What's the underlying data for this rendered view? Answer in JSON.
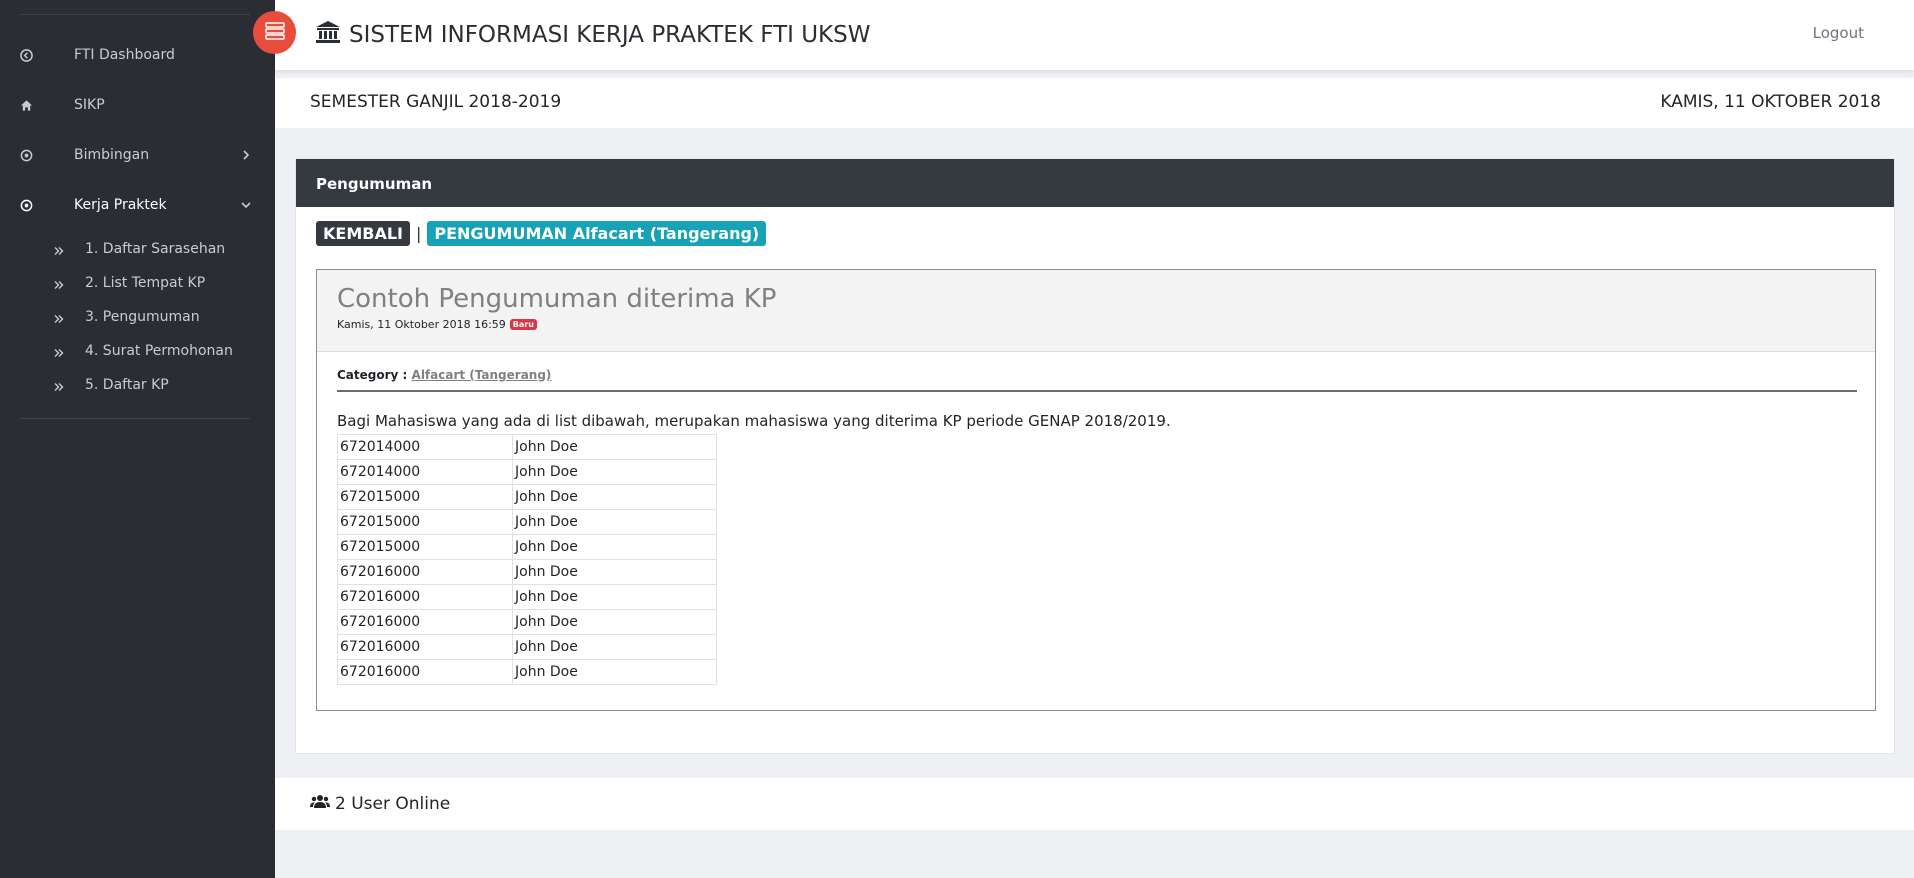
{
  "sidebar": {
    "items": [
      {
        "label": "FTI Dashboard",
        "icon": "arrow-circle-left-icon"
      },
      {
        "label": "SIKP",
        "icon": "home-icon"
      },
      {
        "label": "Bimbingan",
        "icon": "dot-circle-icon"
      },
      {
        "label": "Kerja Praktek",
        "icon": "dot-circle-icon"
      }
    ],
    "subitems": [
      {
        "label": "1. Daftar Sarasehan"
      },
      {
        "label": "2. List Tempat KP"
      },
      {
        "label": "3. Pengumuman"
      },
      {
        "label": "4. Surat Permohonan"
      },
      {
        "label": "5. Daftar KP"
      }
    ]
  },
  "header": {
    "title": "SISTEM INFORMASI KERJA PRAKTEK FTI UKSW",
    "logout": "Logout",
    "semester": "SEMESTER GANJIL 2018-2019",
    "date": "KAMIS, 11 OKTOBER 2018"
  },
  "card": {
    "heading": "Pengumuman",
    "back": "KEMBALI",
    "separator": "|",
    "crumb": "PENGUMUMAN Alfacart (Tangerang)"
  },
  "post": {
    "title": "Contoh Pengumuman diterima KP",
    "meta": "Kamis, 11 Oktober 2018 16:59",
    "badge": "Baru",
    "category_label": "Category :",
    "category_link": "Alfacart (Tangerang)",
    "intro": "Bagi Mahasiswa yang ada di list dibawah, merupakan mahasiswa yang diterima KP periode GENAP 2018/2019.",
    "rows": [
      [
        "672014000",
        "John Doe"
      ],
      [
        "672014000",
        "John Doe"
      ],
      [
        "672015000",
        "John Doe"
      ],
      [
        "672015000",
        "John Doe"
      ],
      [
        "672015000",
        "John Doe"
      ],
      [
        "672016000",
        "John Doe"
      ],
      [
        "672016000",
        "John Doe"
      ],
      [
        "672016000",
        "John Doe"
      ],
      [
        "672016000",
        "John Doe"
      ],
      [
        "672016000",
        "John Doe"
      ]
    ]
  },
  "footer": {
    "online": "2 User Online"
  },
  "colors": {
    "sidebar_bg": "#2a2e34",
    "accent_red": "#e74c3c",
    "info": "#17a2b8",
    "dark": "#343a40"
  }
}
